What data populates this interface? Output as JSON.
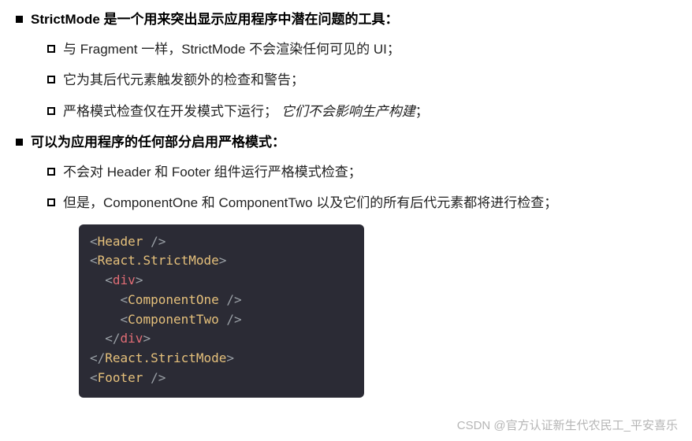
{
  "sections": [
    {
      "heading": "StrictMode 是一个用来突出显示应用程序中潜在问题的工具：",
      "items": [
        {
          "text": "与 Fragment 一样，StrictMode 不会渲染任何可见的 UI；"
        },
        {
          "text": "它为其后代元素触发额外的检查和警告；"
        },
        {
          "text": "严格模式检查仅在开发模式下运行；",
          "italic_tail": "它们不会影响生产构建",
          "tail_punc": "；"
        }
      ]
    },
    {
      "heading": "可以为应用程序的任何部分启用严格模式：",
      "items": [
        {
          "text": "不会对 Header 和 Footer 组件运行严格模式检查；"
        },
        {
          "text": "但是，ComponentOne 和 ComponentTwo 以及它们的所有后代元素都将进行检查；"
        }
      ]
    }
  ],
  "code": [
    [
      {
        "t": "<",
        "c": "punc"
      },
      {
        "t": "Header",
        "c": "tag"
      },
      {
        "t": " />",
        "c": "punc"
      }
    ],
    [
      {
        "t": "<",
        "c": "punc"
      },
      {
        "t": "React.StrictMode",
        "c": "tag"
      },
      {
        "t": ">",
        "c": "punc"
      }
    ],
    [
      {
        "t": "  <",
        "c": "punc"
      },
      {
        "t": "div",
        "c": "div"
      },
      {
        "t": ">",
        "c": "punc"
      }
    ],
    [
      {
        "t": "    <",
        "c": "punc"
      },
      {
        "t": "ComponentOne",
        "c": "tag"
      },
      {
        "t": " />",
        "c": "punc"
      }
    ],
    [
      {
        "t": "    <",
        "c": "punc"
      },
      {
        "t": "ComponentTwo",
        "c": "tag"
      },
      {
        "t": " />",
        "c": "punc"
      }
    ],
    [
      {
        "t": "  </",
        "c": "punc"
      },
      {
        "t": "div",
        "c": "div"
      },
      {
        "t": ">",
        "c": "punc"
      }
    ],
    [
      {
        "t": "</",
        "c": "punc"
      },
      {
        "t": "React.StrictMode",
        "c": "tag"
      },
      {
        "t": ">",
        "c": "punc"
      }
    ],
    [
      {
        "t": "<",
        "c": "punc"
      },
      {
        "t": "Footer",
        "c": "tag"
      },
      {
        "t": " />",
        "c": "punc"
      }
    ]
  ],
  "watermark": "CSDN @官方认证新生代农民工_平安喜乐"
}
